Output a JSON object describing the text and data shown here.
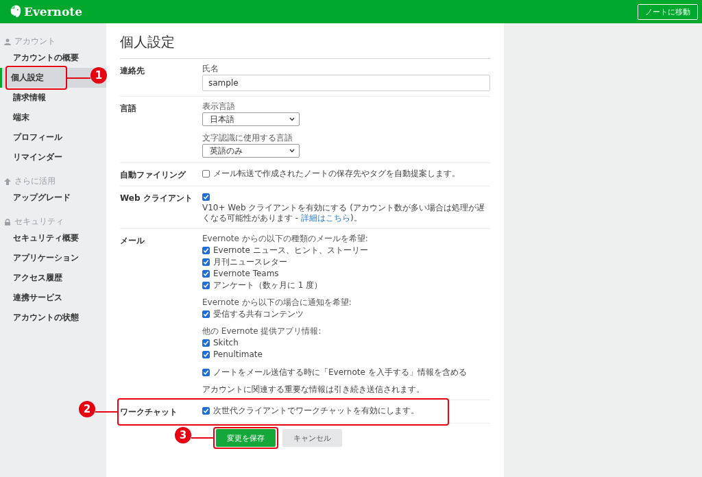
{
  "header": {
    "logo": "Evernote",
    "button": "ノートに移動"
  },
  "sidebar": [
    {
      "heading": "アカウント",
      "items": [
        {
          "label": "アカウントの概要",
          "selected": false
        },
        {
          "label": "個人設定",
          "selected": true
        },
        {
          "label": "請求情報",
          "selected": false
        },
        {
          "label": "端末",
          "selected": false
        },
        {
          "label": "プロフィール",
          "selected": false
        },
        {
          "label": "リマインダー",
          "selected": false
        }
      ]
    },
    {
      "heading": "さらに活用",
      "items": [
        {
          "label": "アップグレード",
          "selected": false
        }
      ]
    },
    {
      "heading": "セキュリティ",
      "items": [
        {
          "label": "セキュリティ概要",
          "selected": false
        },
        {
          "label": "アプリケーション",
          "selected": false
        },
        {
          "label": "アクセス履歴",
          "selected": false
        },
        {
          "label": "連携サービス",
          "selected": false
        },
        {
          "label": "アカウントの状態",
          "selected": false
        }
      ]
    }
  ],
  "page": {
    "title": "個人設定",
    "sections": [
      {
        "label": "連絡先",
        "groups": [
          [
            {
              "kind": "label",
              "text": "氏名"
            },
            {
              "kind": "input",
              "value": "sample"
            }
          ]
        ]
      },
      {
        "label": "言語",
        "groups": [
          [
            {
              "kind": "label",
              "text": "表示言語"
            },
            {
              "kind": "select",
              "value": "日本語"
            }
          ],
          [
            {
              "kind": "label",
              "text": "文字認識に使用する言語"
            },
            {
              "kind": "select",
              "value": "英語のみ"
            }
          ]
        ]
      },
      {
        "label": "自動ファイリング",
        "groups": [
          [
            {
              "kind": "check",
              "checked": false,
              "text": "メール転送で作成されたノートの保存先やタグを自動提案します。"
            }
          ]
        ]
      },
      {
        "label": "Web クライアント",
        "groups": [
          [
            {
              "kind": "check",
              "checked": true
            },
            {
              "kind": "para",
              "text": "V10+ Web クライアントを有効にする (アカウント数が多い場合は処理が遅くなる可能性があります - ",
              "link": "詳細はこちら",
              "after": ")。"
            }
          ]
        ]
      },
      {
        "label": "メール",
        "groups": [
          [
            {
              "kind": "label",
              "text": "Evernote からの以下の種類のメールを希望:"
            },
            {
              "kind": "check",
              "checked": true,
              "text": "Evernote ニュース、ヒント、ストーリー"
            },
            {
              "kind": "check",
              "checked": true,
              "text": "月刊ニュースレター"
            },
            {
              "kind": "check",
              "checked": true,
              "text": "Evernote Teams"
            },
            {
              "kind": "check",
              "checked": true,
              "text": "アンケート（数ヶ月に 1 度）"
            }
          ],
          [
            {
              "kind": "label",
              "text": "Evernote から以下の場合に通知を希望:"
            },
            {
              "kind": "check",
              "checked": true,
              "text": "受信する共有コンテンツ"
            }
          ],
          [
            {
              "kind": "label",
              "text": "他の Evernote 提供アプリ情報:"
            },
            {
              "kind": "check",
              "checked": true,
              "text": "Skitch"
            },
            {
              "kind": "check",
              "checked": true,
              "text": "Penultimate"
            }
          ],
          [
            {
              "kind": "check",
              "checked": true,
              "text": "ノートをメール送信する時に「Evernote を入手する」情報を含める"
            }
          ],
          [
            {
              "kind": "note",
              "text": "アカウントに関連する重要な情報は引き続き送信されます。"
            }
          ]
        ]
      },
      {
        "label": "ワークチャット",
        "groups": [
          [
            {
              "kind": "check",
              "checked": true,
              "text": "次世代クライアントでワークチャットを有効にします。"
            }
          ]
        ]
      }
    ],
    "buttons": [
      {
        "label": "変更を保存",
        "kind": "primary"
      },
      {
        "label": "キャンセル",
        "kind": "secondary"
      }
    ]
  },
  "annotations": [
    {
      "number": "1"
    },
    {
      "number": "2"
    },
    {
      "number": "3"
    }
  ]
}
